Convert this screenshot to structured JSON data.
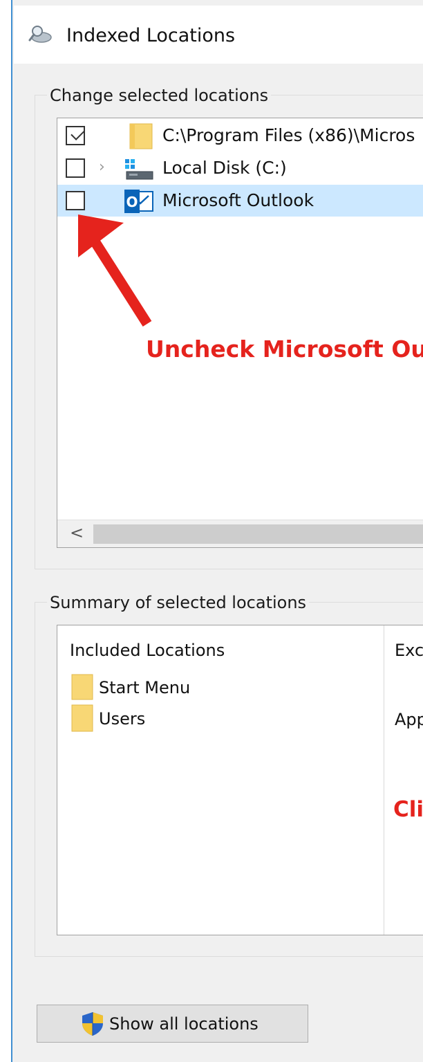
{
  "window": {
    "title": "Indexed Locations",
    "title_icon": "indexing-options-icon"
  },
  "change_group": {
    "legend": "Change selected locations",
    "rows": [
      {
        "label": "C:\\Program Files (x86)\\Micros",
        "checked": true,
        "icon": "folder-icon",
        "selected": false
      },
      {
        "label": "Local Disk (C:)",
        "checked": false,
        "icon": "local-disk-icon",
        "selected": false,
        "expandable": true
      },
      {
        "label": "Microsoft Outlook",
        "checked": false,
        "icon": "outlook-icon",
        "selected": true
      }
    ],
    "scroll_left_glyph": "<"
  },
  "annotations": {
    "uncheck_text": "Uncheck Microsoft Out",
    "click_text": "Cli"
  },
  "summary_group": {
    "legend": "Summary of selected locations",
    "included_header": "Included Locations",
    "included": [
      "Start Menu",
      "Users"
    ],
    "excluded_header": "Exc",
    "excluded": [
      "App"
    ]
  },
  "buttons": {
    "show_all": "Show all locations",
    "show_all_icon": "uac-shield-icon"
  },
  "colors": {
    "annotation_red": "#e5231d",
    "selection_blue": "#cce8ff",
    "window_accent": "#3f8fd2"
  }
}
